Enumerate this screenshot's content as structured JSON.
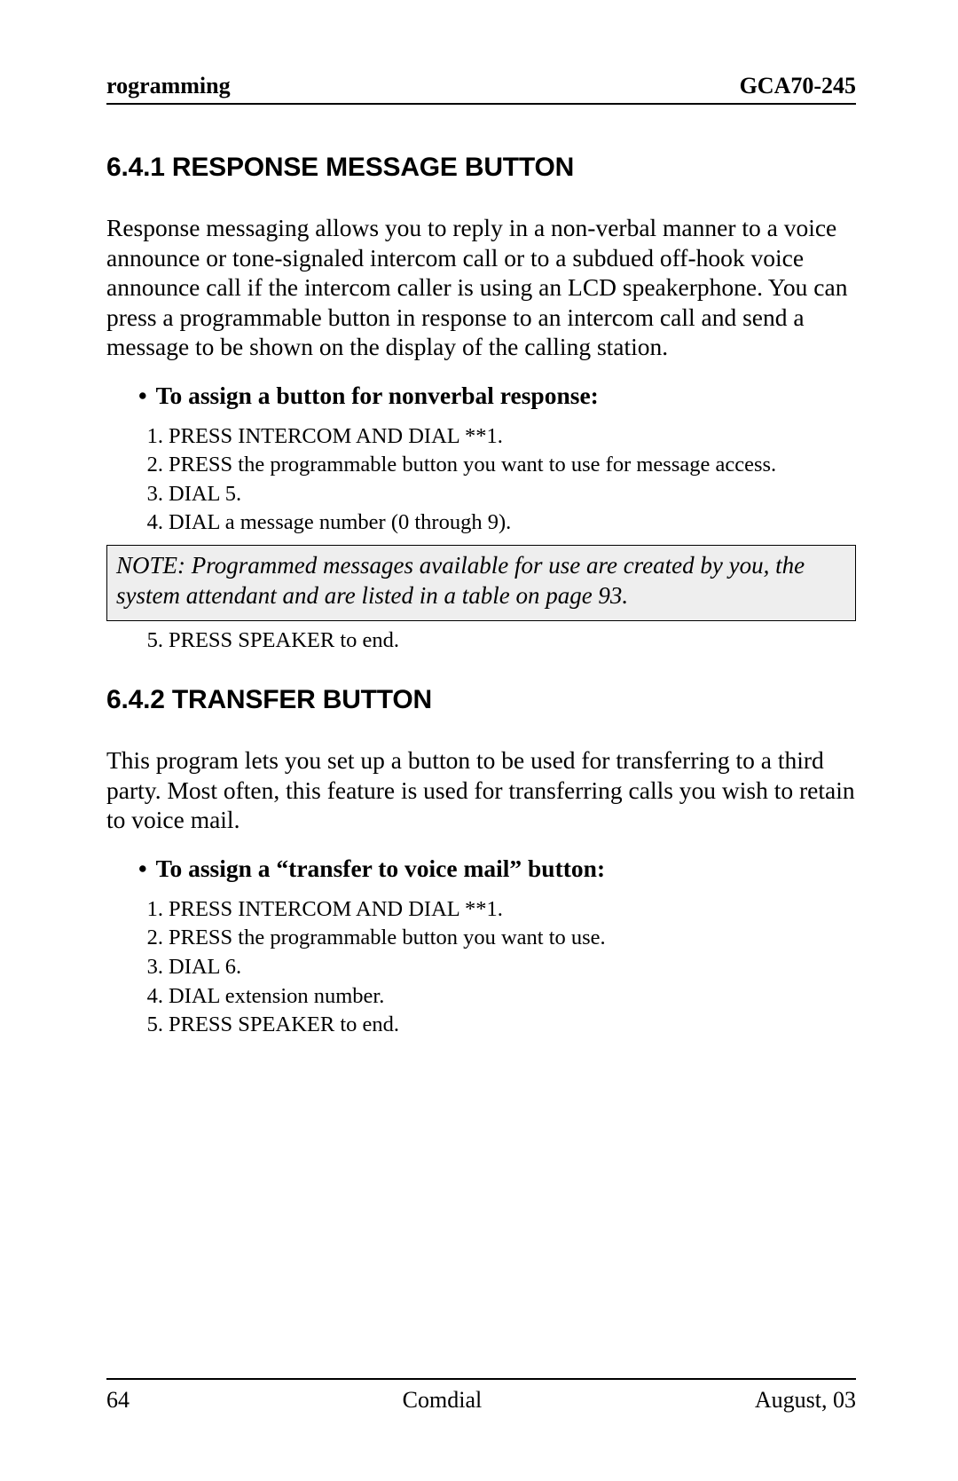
{
  "header": {
    "left": "rogramming",
    "right": "GCA70-245"
  },
  "section1": {
    "heading": "6.4.1  RESPONSE MESSAGE BUTTON",
    "paragraph": "Response messaging allows you to reply in a non-verbal manner to a voice announce or tone-signaled intercom call or to a subdued off-hook voice announce call if the intercom caller is using an LCD speakerphone. You can press a programmable button in response to an intercom call and send a message to be shown on the display of the calling station.",
    "bullet": "To assign a button for nonverbal response:",
    "steps_a": [
      "PRESS INTERCOM  AND DIAL  **1.",
      "PRESS the programmable button you want to use for message access.",
      "DIAL   5.",
      "DIAL a message number (0 through 9)."
    ],
    "note": "NOTE: Programmed messages available for use are created by you, the system attendant and are listed in a table on page 93.",
    "steps_b": [
      "PRESS SPEAKER to end."
    ],
    "steps_b_start": 5
  },
  "section2": {
    "heading": "6.4.2  TRANSFER BUTTON",
    "paragraph": "This program lets you set up a button to be used for transferring to a third party.  Most often, this feature is used for transferring calls you wish to retain to  voice mail.",
    "bullet": "To assign a “transfer to voice mail” button:",
    "steps": [
      "PRESS INTERCOM AND DIAL  **1.",
      "PRESS the programmable button you want to use.",
      "DIAL   6.",
      "DIAL extension number.",
      "PRESS SPEAKER to end."
    ]
  },
  "footer": {
    "left": "64",
    "center": "Comdial",
    "right": "August, 03"
  }
}
